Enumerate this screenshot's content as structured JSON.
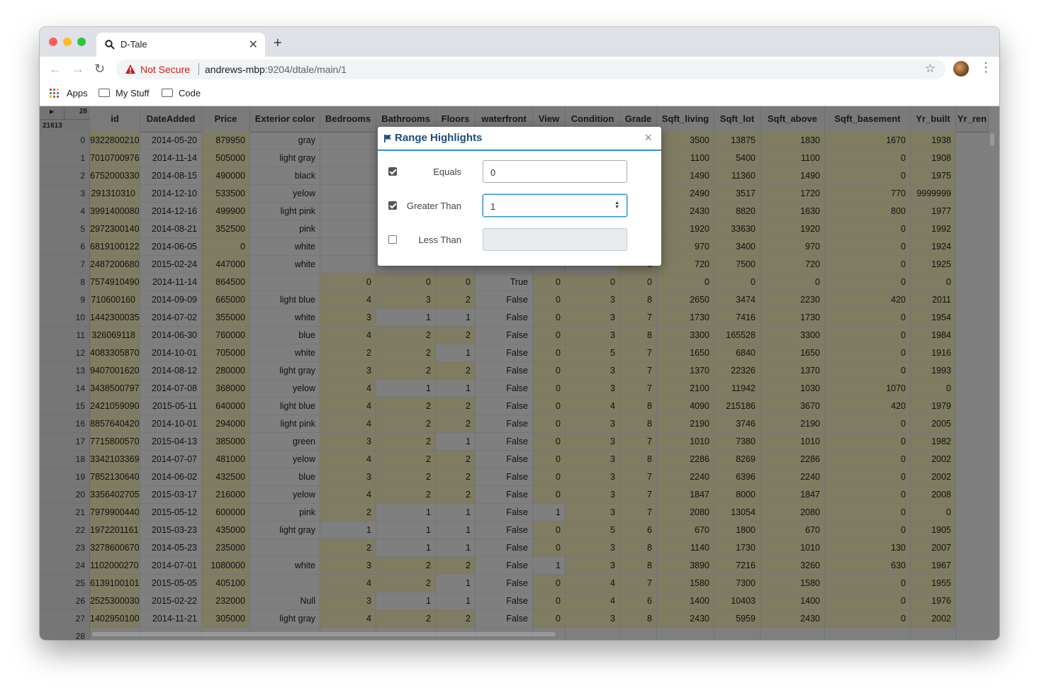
{
  "browser": {
    "tab_title": "D-Tale",
    "not_secure": "Not Secure",
    "url_host": "andrews-mbp",
    "url_path": ":9204/dtale/main/1",
    "bookmarks": [
      "Apps",
      "My Stuff",
      "Code"
    ]
  },
  "grid": {
    "total_columns": "28",
    "total_rows": "21613",
    "columns": [
      "id",
      "DateAdded",
      "Price",
      "Exterior color",
      "Bedrooms",
      "Bathrooms",
      "Floors",
      "waterfront",
      "View",
      "Condition",
      "Grade",
      "Sqft_living",
      "Sqft_lot",
      "Sqft_above",
      "Sqft_basement",
      "Yr_built",
      "Yr_ren"
    ],
    "rows": [
      [
        "0",
        "9322800210",
        "2014-05-20",
        "879950",
        "gray",
        "",
        "",
        "",
        "",
        "",
        "",
        "9",
        "3500",
        "13875",
        "1830",
        "1670",
        "1938"
      ],
      [
        "1",
        "7010700976",
        "2014-11-14",
        "505000",
        "light gray",
        "",
        "",
        "",
        "",
        "",
        "",
        "7",
        "1100",
        "5400",
        "1100",
        "0",
        "1908"
      ],
      [
        "2",
        "6752000330",
        "2014-08-15",
        "490000",
        "black",
        "",
        "",
        "",
        "",
        "",
        "",
        "8",
        "1490",
        "11360",
        "1490",
        "0",
        "1975"
      ],
      [
        "3",
        "291310310",
        "2014-12-10",
        "533500",
        "yelow",
        "",
        "",
        "",
        "",
        "",
        "",
        "8",
        "2490",
        "3517",
        "1720",
        "770",
        "9999999"
      ],
      [
        "4",
        "3991400080",
        "2014-12-16",
        "499900",
        "light pink",
        "",
        "",
        "",
        "",
        "",
        "",
        "8",
        "2430",
        "8820",
        "1630",
        "800",
        "1977"
      ],
      [
        "5",
        "2972300140",
        "2014-08-21",
        "352500",
        "pink",
        "",
        "",
        "",
        "",
        "",
        "",
        "8",
        "1920",
        "33630",
        "1920",
        "0",
        "1992"
      ],
      [
        "6",
        "6819100122",
        "2014-06-05",
        "0",
        "white",
        "",
        "",
        "",
        "",
        "",
        "",
        "7",
        "970",
        "3400",
        "970",
        "0",
        "1924"
      ],
      [
        "7",
        "2487200680",
        "2015-02-24",
        "447000",
        "white",
        "",
        "",
        "",
        "",
        "",
        "",
        "6",
        "720",
        "7500",
        "720",
        "0",
        "1925"
      ],
      [
        "8",
        "7574910490",
        "2014-11-14",
        "864500",
        "",
        "0",
        "0",
        "0",
        "True",
        "0",
        "0",
        "0",
        "0",
        "0",
        "0",
        "0",
        "0"
      ],
      [
        "9",
        "710600160",
        "2014-09-09",
        "665000",
        "light blue",
        "4",
        "3",
        "2",
        "False",
        "0",
        "3",
        "8",
        "2650",
        "3474",
        "2230",
        "420",
        "2011"
      ],
      [
        "10",
        "1442300035",
        "2014-07-02",
        "355000",
        "white",
        "3",
        "1",
        "1",
        "False",
        "0",
        "3",
        "7",
        "1730",
        "7416",
        "1730",
        "0",
        "1954"
      ],
      [
        "11",
        "326069118",
        "2014-06-30",
        "760000",
        "blue",
        "4",
        "2",
        "2",
        "False",
        "0",
        "3",
        "8",
        "3300",
        "165528",
        "3300",
        "0",
        "1984"
      ],
      [
        "12",
        "4083305870",
        "2014-10-01",
        "705000",
        "white",
        "2",
        "2",
        "1",
        "False",
        "0",
        "5",
        "7",
        "1650",
        "6840",
        "1650",
        "0",
        "1916"
      ],
      [
        "13",
        "9407001620",
        "2014-08-12",
        "280000",
        "light gray",
        "3",
        "2",
        "2",
        "False",
        "0",
        "3",
        "7",
        "1370",
        "22326",
        "1370",
        "0",
        "1993"
      ],
      [
        "14",
        "3438500797",
        "2014-07-08",
        "368000",
        "yelow",
        "4",
        "1",
        "1",
        "False",
        "0",
        "3",
        "7",
        "2100",
        "11942",
        "1030",
        "1070",
        "0"
      ],
      [
        "15",
        "2421059090",
        "2015-05-11",
        "640000",
        "light blue",
        "4",
        "2",
        "2",
        "False",
        "0",
        "4",
        "8",
        "4090",
        "215186",
        "3670",
        "420",
        "1979"
      ],
      [
        "16",
        "8857640420",
        "2014-10-01",
        "294000",
        "light pink",
        "4",
        "2",
        "2",
        "False",
        "0",
        "3",
        "8",
        "2190",
        "3746",
        "2190",
        "0",
        "2005"
      ],
      [
        "17",
        "7715800570",
        "2015-04-13",
        "385000",
        "green",
        "3",
        "2",
        "1",
        "False",
        "0",
        "3",
        "7",
        "1010",
        "7380",
        "1010",
        "0",
        "1982"
      ],
      [
        "18",
        "3342103369",
        "2014-07-07",
        "481000",
        "yelow",
        "4",
        "2",
        "2",
        "False",
        "0",
        "3",
        "8",
        "2286",
        "8269",
        "2286",
        "0",
        "2002"
      ],
      [
        "19",
        "7852130640",
        "2014-06-02",
        "432500",
        "blue",
        "3",
        "2",
        "2",
        "False",
        "0",
        "3",
        "7",
        "2240",
        "6396",
        "2240",
        "0",
        "2002"
      ],
      [
        "20",
        "3356402705",
        "2015-03-17",
        "216000",
        "yelow",
        "4",
        "2",
        "2",
        "False",
        "0",
        "3",
        "7",
        "1847",
        "8000",
        "1847",
        "0",
        "2008"
      ],
      [
        "21",
        "7979900440",
        "2015-05-12",
        "600000",
        "pink",
        "2",
        "1",
        "1",
        "False",
        "1",
        "3",
        "7",
        "2080",
        "13054",
        "2080",
        "0",
        "0"
      ],
      [
        "22",
        "1972201161",
        "2015-03-23",
        "435000",
        "light gray",
        "1",
        "1",
        "1",
        "False",
        "0",
        "5",
        "6",
        "670",
        "1800",
        "670",
        "0",
        "1905"
      ],
      [
        "23",
        "3278600670",
        "2014-05-23",
        "235000",
        "",
        "2",
        "1",
        "1",
        "False",
        "0",
        "3",
        "8",
        "1140",
        "1730",
        "1010",
        "130",
        "2007"
      ],
      [
        "24",
        "1102000270",
        "2014-07-01",
        "1080000",
        "white",
        "3",
        "2",
        "2",
        "False",
        "1",
        "3",
        "8",
        "3890",
        "7216",
        "3260",
        "630",
        "1967"
      ],
      [
        "25",
        "6139100101",
        "2015-05-05",
        "405100",
        "",
        "4",
        "2",
        "1",
        "False",
        "0",
        "4",
        "7",
        "1580",
        "7300",
        "1580",
        "0",
        "1955"
      ],
      [
        "26",
        "2525300030",
        "2015-02-22",
        "232000",
        "Null",
        "3",
        "1",
        "1",
        "False",
        "0",
        "4",
        "6",
        "1400",
        "10403",
        "1400",
        "0",
        "1976"
      ],
      [
        "27",
        "1402950100",
        "2014-11-21",
        "305000",
        "light gray",
        "4",
        "2",
        "2",
        "False",
        "0",
        "3",
        "8",
        "2430",
        "5959",
        "2430",
        "0",
        "2002"
      ],
      [
        "28",
        "",
        "",
        "",
        "",
        "",
        "",
        "",
        "",
        "",
        "",
        "",
        "",
        "",
        "",
        "",
        ""
      ]
    ]
  },
  "modal": {
    "title": "Range Highlights",
    "close": "×",
    "equals_label": "Equals",
    "equals_value": "0",
    "greater_label": "Greater Than",
    "greater_value": "1",
    "less_label": "Less Than",
    "less_value": ""
  },
  "colors": {
    "highlight": "#fff9c4",
    "accent": "#2a91d1",
    "title": "#1f4d79"
  }
}
